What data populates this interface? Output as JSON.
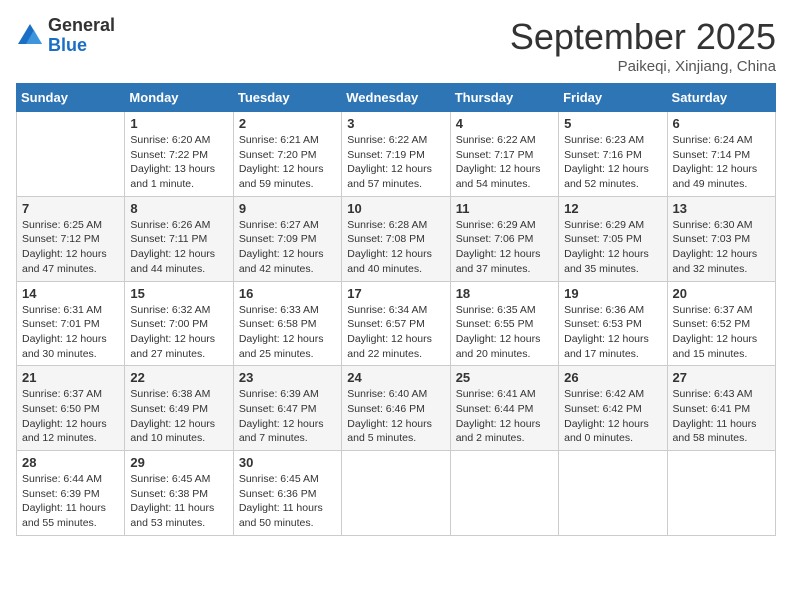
{
  "header": {
    "logo_general": "General",
    "logo_blue": "Blue",
    "month_title": "September 2025",
    "location": "Paikeqi, Xinjiang, China"
  },
  "days_of_week": [
    "Sunday",
    "Monday",
    "Tuesday",
    "Wednesday",
    "Thursday",
    "Friday",
    "Saturday"
  ],
  "weeks": [
    [
      {
        "day": "",
        "info": ""
      },
      {
        "day": "1",
        "info": "Sunrise: 6:20 AM\nSunset: 7:22 PM\nDaylight: 13 hours\nand 1 minute."
      },
      {
        "day": "2",
        "info": "Sunrise: 6:21 AM\nSunset: 7:20 PM\nDaylight: 12 hours\nand 59 minutes."
      },
      {
        "day": "3",
        "info": "Sunrise: 6:22 AM\nSunset: 7:19 PM\nDaylight: 12 hours\nand 57 minutes."
      },
      {
        "day": "4",
        "info": "Sunrise: 6:22 AM\nSunset: 7:17 PM\nDaylight: 12 hours\nand 54 minutes."
      },
      {
        "day": "5",
        "info": "Sunrise: 6:23 AM\nSunset: 7:16 PM\nDaylight: 12 hours\nand 52 minutes."
      },
      {
        "day": "6",
        "info": "Sunrise: 6:24 AM\nSunset: 7:14 PM\nDaylight: 12 hours\nand 49 minutes."
      }
    ],
    [
      {
        "day": "7",
        "info": "Sunrise: 6:25 AM\nSunset: 7:12 PM\nDaylight: 12 hours\nand 47 minutes."
      },
      {
        "day": "8",
        "info": "Sunrise: 6:26 AM\nSunset: 7:11 PM\nDaylight: 12 hours\nand 44 minutes."
      },
      {
        "day": "9",
        "info": "Sunrise: 6:27 AM\nSunset: 7:09 PM\nDaylight: 12 hours\nand 42 minutes."
      },
      {
        "day": "10",
        "info": "Sunrise: 6:28 AM\nSunset: 7:08 PM\nDaylight: 12 hours\nand 40 minutes."
      },
      {
        "day": "11",
        "info": "Sunrise: 6:29 AM\nSunset: 7:06 PM\nDaylight: 12 hours\nand 37 minutes."
      },
      {
        "day": "12",
        "info": "Sunrise: 6:29 AM\nSunset: 7:05 PM\nDaylight: 12 hours\nand 35 minutes."
      },
      {
        "day": "13",
        "info": "Sunrise: 6:30 AM\nSunset: 7:03 PM\nDaylight: 12 hours\nand 32 minutes."
      }
    ],
    [
      {
        "day": "14",
        "info": "Sunrise: 6:31 AM\nSunset: 7:01 PM\nDaylight: 12 hours\nand 30 minutes."
      },
      {
        "day": "15",
        "info": "Sunrise: 6:32 AM\nSunset: 7:00 PM\nDaylight: 12 hours\nand 27 minutes."
      },
      {
        "day": "16",
        "info": "Sunrise: 6:33 AM\nSunset: 6:58 PM\nDaylight: 12 hours\nand 25 minutes."
      },
      {
        "day": "17",
        "info": "Sunrise: 6:34 AM\nSunset: 6:57 PM\nDaylight: 12 hours\nand 22 minutes."
      },
      {
        "day": "18",
        "info": "Sunrise: 6:35 AM\nSunset: 6:55 PM\nDaylight: 12 hours\nand 20 minutes."
      },
      {
        "day": "19",
        "info": "Sunrise: 6:36 AM\nSunset: 6:53 PM\nDaylight: 12 hours\nand 17 minutes."
      },
      {
        "day": "20",
        "info": "Sunrise: 6:37 AM\nSunset: 6:52 PM\nDaylight: 12 hours\nand 15 minutes."
      }
    ],
    [
      {
        "day": "21",
        "info": "Sunrise: 6:37 AM\nSunset: 6:50 PM\nDaylight: 12 hours\nand 12 minutes."
      },
      {
        "day": "22",
        "info": "Sunrise: 6:38 AM\nSunset: 6:49 PM\nDaylight: 12 hours\nand 10 minutes."
      },
      {
        "day": "23",
        "info": "Sunrise: 6:39 AM\nSunset: 6:47 PM\nDaylight: 12 hours\nand 7 minutes."
      },
      {
        "day": "24",
        "info": "Sunrise: 6:40 AM\nSunset: 6:46 PM\nDaylight: 12 hours\nand 5 minutes."
      },
      {
        "day": "25",
        "info": "Sunrise: 6:41 AM\nSunset: 6:44 PM\nDaylight: 12 hours\nand 2 minutes."
      },
      {
        "day": "26",
        "info": "Sunrise: 6:42 AM\nSunset: 6:42 PM\nDaylight: 12 hours\nand 0 minutes."
      },
      {
        "day": "27",
        "info": "Sunrise: 6:43 AM\nSunset: 6:41 PM\nDaylight: 11 hours\nand 58 minutes."
      }
    ],
    [
      {
        "day": "28",
        "info": "Sunrise: 6:44 AM\nSunset: 6:39 PM\nDaylight: 11 hours\nand 55 minutes."
      },
      {
        "day": "29",
        "info": "Sunrise: 6:45 AM\nSunset: 6:38 PM\nDaylight: 11 hours\nand 53 minutes."
      },
      {
        "day": "30",
        "info": "Sunrise: 6:45 AM\nSunset: 6:36 PM\nDaylight: 11 hours\nand 50 minutes."
      },
      {
        "day": "",
        "info": ""
      },
      {
        "day": "",
        "info": ""
      },
      {
        "day": "",
        "info": ""
      },
      {
        "day": "",
        "info": ""
      }
    ]
  ]
}
